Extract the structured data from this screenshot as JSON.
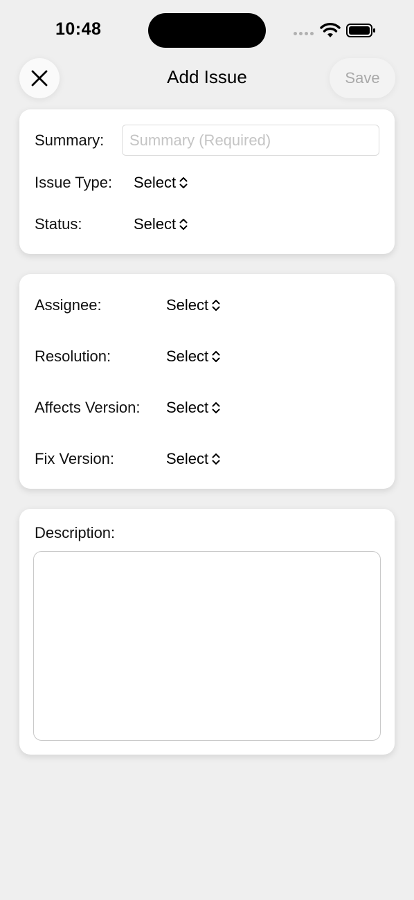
{
  "status_bar": {
    "time": "10:48"
  },
  "nav": {
    "title": "Add Issue",
    "save_label": "Save",
    "close_icon": "close-icon"
  },
  "details": {
    "summary_label": "Summary:",
    "summary_placeholder": "Summary (Required)",
    "summary_value": "",
    "issue_type_label": "Issue Type:",
    "issue_type_value": "Select",
    "status_label": "Status:",
    "status_value": "Select"
  },
  "fields": {
    "assignee_label": "Assignee:",
    "assignee_value": "Select",
    "resolution_label": "Resolution:",
    "resolution_value": "Select",
    "affects_version_label": "Affects Version:",
    "affects_version_value": "Select",
    "fix_version_label": "Fix Version:",
    "fix_version_value": "Select"
  },
  "description": {
    "label": "Description:",
    "value": ""
  },
  "colors": {
    "background": "#efefef",
    "card": "#ffffff",
    "disabled_text": "#a9a9a9",
    "placeholder_text": "#c4c4c4"
  }
}
